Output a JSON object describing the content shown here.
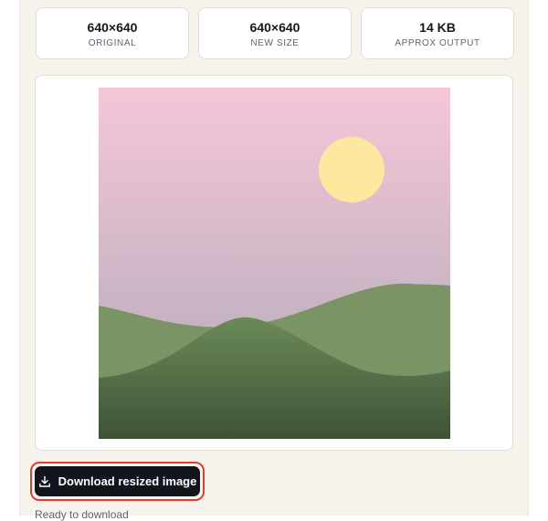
{
  "stats": [
    {
      "value": "640×640",
      "label": "ORIGINAL"
    },
    {
      "value": "640×640",
      "label": "NEW SIZE"
    },
    {
      "value": "14 KB",
      "label": "APPROX OUTPUT"
    }
  ],
  "preview": {
    "colors": {
      "sky_top": "#f5c6d8",
      "sky_bottom": "#aeaab8",
      "sun": "#fde8a0",
      "hill_back": "#7a9466",
      "hill_front_top": "#6b8a58",
      "hill_front_bottom": "#3e5237"
    }
  },
  "download": {
    "label": "Download resized image",
    "icon": "download-icon",
    "bg_color": "#12151c",
    "highlight_color": "#e0402b"
  },
  "status": "Ready to download"
}
